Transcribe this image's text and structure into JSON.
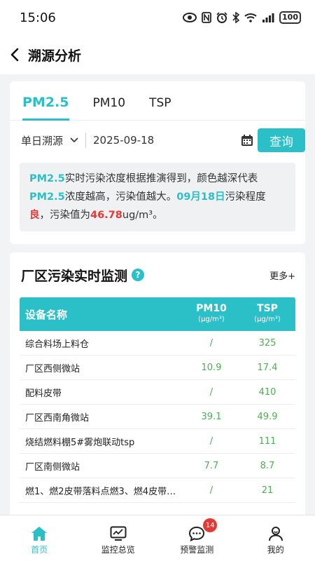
{
  "status_bar": {
    "time": "15:06",
    "battery": "100"
  },
  "nav": {
    "title": "溯源分析"
  },
  "tabs": [
    {
      "label": "PM2.5",
      "active": true
    },
    {
      "label": "PM10",
      "active": false
    },
    {
      "label": "TSP",
      "active": false
    }
  ],
  "filter": {
    "mode": "单日溯源",
    "date": "2025-09-18",
    "query_label": "查询"
  },
  "info": {
    "pollutant": "PM2.5",
    "text1": "实时污染浓度根据推演得到，颜色越深代表",
    "text2": "浓度越高，污染值越大。",
    "date": "09月18日",
    "text3": "污染程度",
    "level": "良",
    "text4": "，污染值为",
    "value": "46.78",
    "unit": "ug/m³。"
  },
  "monitor": {
    "title": "厂区污染实时监测",
    "help": "?",
    "more": "更多+",
    "headers": {
      "name": "设备名称",
      "pm10": "PM10",
      "pm10_unit": "(μg/m³)",
      "tsp": "TSP",
      "tsp_unit": "(μg/m³)"
    },
    "rows": [
      {
        "name": "综合料场上料仓",
        "pm10": "/",
        "tsp": "325"
      },
      {
        "name": "厂区西侧微站",
        "pm10": "10.9",
        "tsp": "17.4"
      },
      {
        "name": "配料皮带",
        "pm10": "/",
        "tsp": "410"
      },
      {
        "name": "厂区西南角微站",
        "pm10": "39.1",
        "tsp": "49.9"
      },
      {
        "name": "烧结燃料棚5#雾炮联动tsp",
        "pm10": "/",
        "tsp": "111"
      },
      {
        "name": "厂区南侧微站",
        "pm10": "7.7",
        "tsp": "8.7"
      },
      {
        "name": "燃1、燃2皮带落料点燃3、燃4皮带受…",
        "pm10": "/",
        "tsp": "21"
      }
    ]
  },
  "tab_bar": {
    "home": "首页",
    "overview": "监控总览",
    "alerts": "预警监测",
    "alerts_badge": "14",
    "mine": "我的"
  },
  "colors": {
    "accent": "#2bbfc8",
    "value_green": "#4caf50",
    "highlight_red": "#e53935"
  }
}
